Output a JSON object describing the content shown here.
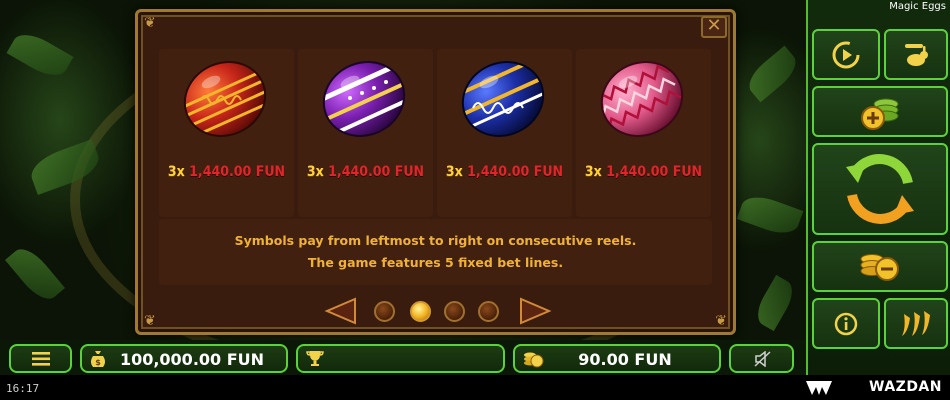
{
  "game": {
    "title": "Magic Eggs",
    "brand": "WAZDAN",
    "clock": "16:17"
  },
  "paytable": {
    "symbols": [
      {
        "name": "red-gold-egg",
        "multiplier": "3x",
        "amount": "1,440.00 FUN",
        "colors": {
          "base": "#c8261a",
          "accent": "#f2b62a"
        }
      },
      {
        "name": "purple-egg",
        "multiplier": "3x",
        "amount": "1,440.00 FUN",
        "colors": {
          "base": "#7a1fb0",
          "accent": "#f2d24a"
        }
      },
      {
        "name": "blue-egg",
        "multiplier": "3x",
        "amount": "1,440.00 FUN",
        "colors": {
          "base": "#1c2fa8",
          "accent": "#f2b62a"
        }
      },
      {
        "name": "pink-pattern-egg",
        "multiplier": "3x",
        "amount": "1,440.00 FUN",
        "colors": {
          "base": "#e25a8a",
          "accent": "#f7d6e0"
        }
      }
    ],
    "rules": [
      "Symbols pay from leftmost to right on consecutive reels.",
      "The game features 5 fixed bet lines."
    ],
    "pager": {
      "pages": 4,
      "active_page": 2
    }
  },
  "bottom_bar": {
    "menu_icon": "hamburger-icon",
    "balance": "100,000.00 FUN",
    "win": "",
    "bet": "90.00 FUN"
  },
  "sidebar": {
    "buttons": [
      "autoplay-icon",
      "speed-rabbit-icon",
      "add-credits-icon",
      "spin-icon",
      "decrease-bet-icon",
      "info-icon",
      "volatility-chili-icon"
    ]
  },
  "colors": {
    "accent_green": "#5bd23a",
    "panel_bg": "#3a1c0e",
    "panel_border": "#a07a32",
    "rules_text": "#f0b235",
    "multiplier": "#ffd23a",
    "amount": "#e0252b"
  }
}
